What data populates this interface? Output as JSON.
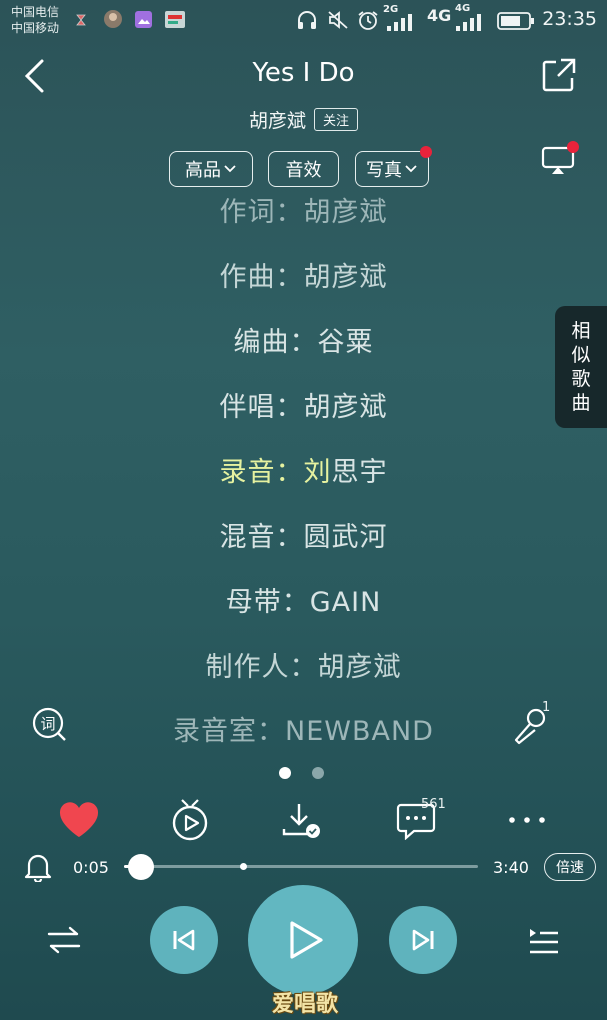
{
  "status_bar": {
    "carrier_1": "中国电信",
    "carrier_2": "中国移动",
    "network_1": "2G",
    "network_2": "4G",
    "network_3": "4G",
    "time": "23:35"
  },
  "header": {
    "title": "Yes I Do",
    "artist": "胡彦斌",
    "follow_label": "关注",
    "quality_label": "高品",
    "effect_label": "音效",
    "photo_label": "写真"
  },
  "lyrics": [
    {
      "text": "作词：胡彦斌"
    },
    {
      "text": "作曲：胡彦斌"
    },
    {
      "text": "编曲：谷粟"
    },
    {
      "text": "伴唱：胡彦斌"
    },
    {
      "highlight": "录音：刘",
      "rest": "思宇"
    },
    {
      "text": "混音：圆武河"
    },
    {
      "text": "母带：GAIN"
    },
    {
      "text": "制作人：胡彦斌"
    },
    {
      "text": "录音室：NEWBAND"
    }
  ],
  "similar_songs_label": [
    "相",
    "似",
    "歌",
    "曲"
  ],
  "mic_count": "1",
  "comment_count": "561",
  "player": {
    "current_time": "0:05",
    "total_time": "3:40",
    "speed_label": "倍速",
    "progress": 0.024
  },
  "page_indicator": {
    "count": 2,
    "active": 0
  },
  "watermark": "爱唱歌",
  "colors": {
    "accent_circle": "#5fb3bd",
    "heart": "#f0464f",
    "highlight": "#e6f2a0",
    "notification_dot": "#e8233b"
  }
}
